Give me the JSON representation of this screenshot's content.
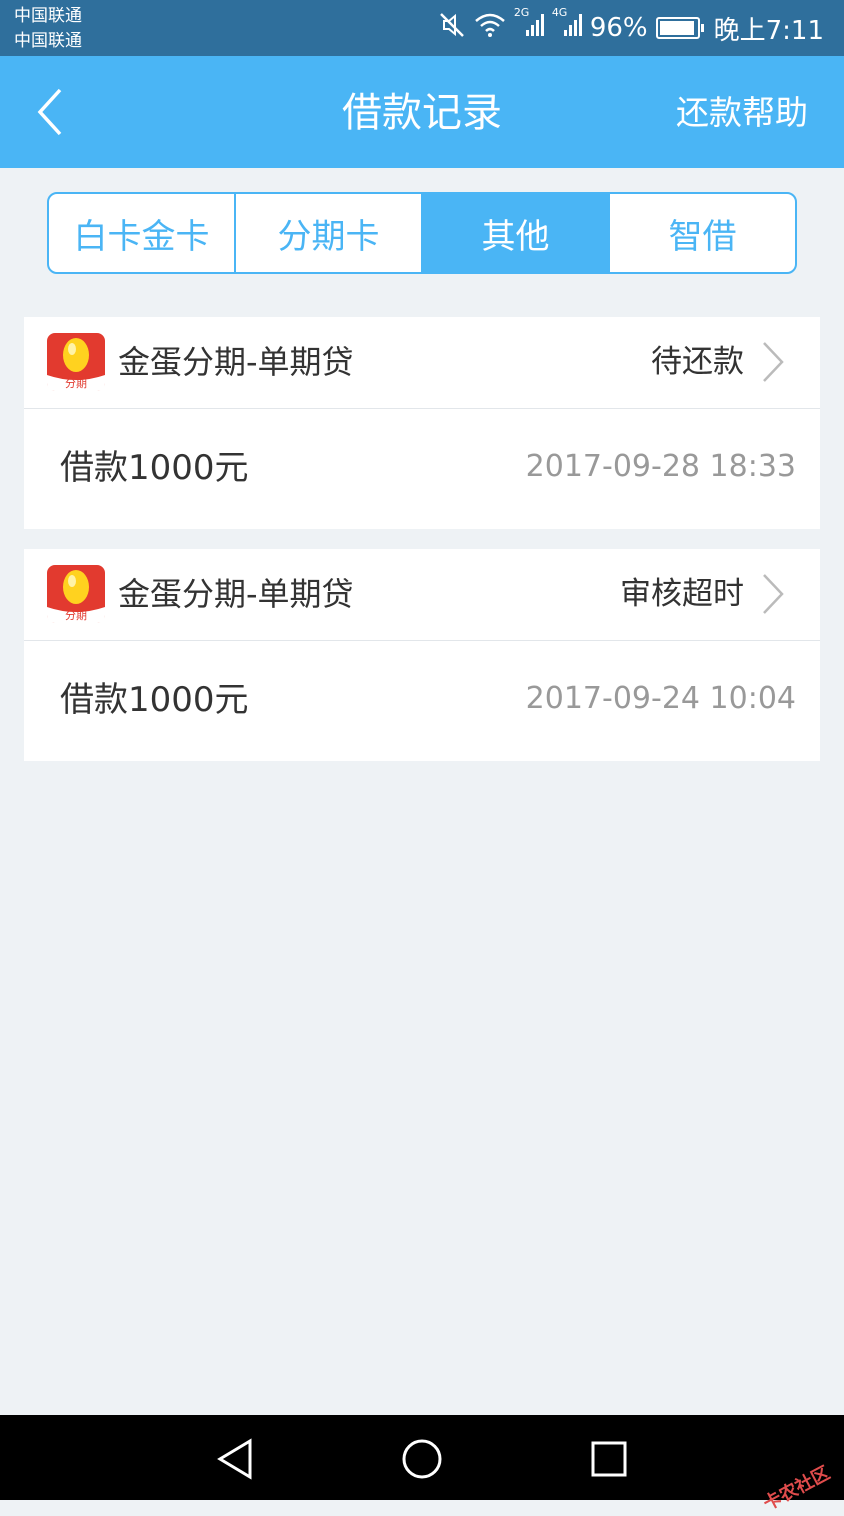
{
  "status_bar": {
    "carrier_1": "中国联通",
    "carrier_2": "中国联通",
    "network_2g": "2G",
    "network_4g": "4G",
    "battery": "96%",
    "battery_level": 0.96,
    "time": "晚上7:11"
  },
  "header": {
    "title": "借款记录",
    "help_label": "还款帮助"
  },
  "tabs": [
    {
      "label": "白卡金卡",
      "active": false
    },
    {
      "label": "分期卡",
      "active": false
    },
    {
      "label": "其他",
      "active": true
    },
    {
      "label": "智借",
      "active": false
    }
  ],
  "records": [
    {
      "logo_text": "分期",
      "product": "金蛋分期-单期贷",
      "status": "待还款",
      "amount": "借款1000元",
      "date": "2017-09-28 18:33"
    },
    {
      "logo_text": "分期",
      "product": "金蛋分期-单期贷",
      "status": "审核超时",
      "amount": "借款1000元",
      "date": "2017-09-24 10:04"
    }
  ],
  "watermark": "卡农社区",
  "colors": {
    "accent": "#4ab5f5",
    "status_bar": "#2f6f9c",
    "background": "#eef2f5",
    "logo_red": "#e23a2f"
  }
}
